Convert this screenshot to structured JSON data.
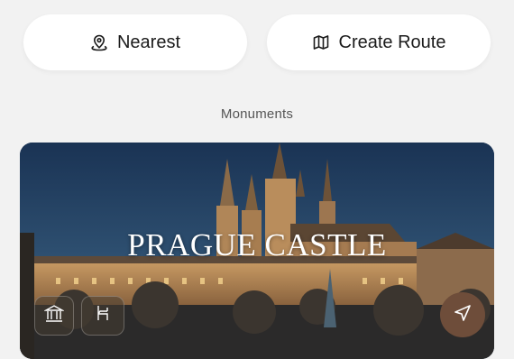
{
  "top_buttons": {
    "nearest_label": "Nearest",
    "nearest_icon": "location-pin-icon",
    "route_label": "Create Route",
    "route_icon": "map-icon"
  },
  "section": {
    "label": "Monuments"
  },
  "card": {
    "title": "PRAGUE CASTLE",
    "badges": [
      "museum-icon",
      "chair-icon"
    ],
    "action_icon": "navigation-arrow-icon",
    "accent_color": "#6e4d3a"
  }
}
